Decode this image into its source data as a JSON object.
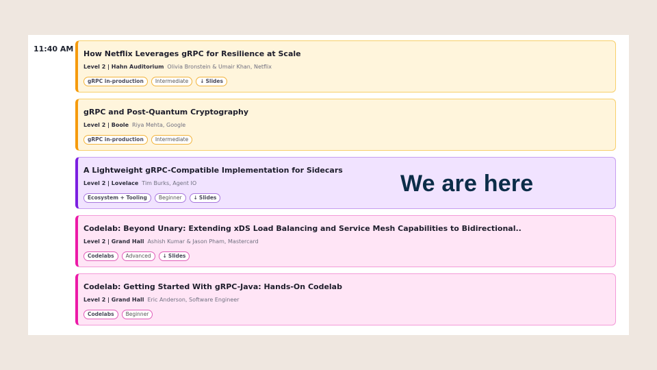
{
  "time": "11:40 AM",
  "overlay_text": "We are here",
  "colors": {
    "page_bg": "#efe7e0",
    "orange_accent": "#f59a0c",
    "purple_accent": "#7b1fe0",
    "pink_accent": "#ec1aa7",
    "overlay": "#0c2d48"
  },
  "sessions": [
    {
      "title": "How Netflix Leverages gRPC for Resilience at Scale",
      "location": "Level 2 | Hahn Auditorium",
      "speakers": "Olivia Bronstein & Umair Khan, Netflix",
      "track": "gRPC in-production",
      "level": "Intermediate",
      "slides": "Slides"
    },
    {
      "title": "gRPC and Post-Quantum Cryptography",
      "location": "Level 2 | Boole",
      "speakers": "Riya Mehta, Google",
      "track": "gRPC in-production",
      "level": "Intermediate"
    },
    {
      "title": "A Lightweight gRPC-Compatible Implementation for Sidecars",
      "location": "Level 2 | Lovelace",
      "speakers": "Tim Burks, Agent IO",
      "track": "Ecosystem + Tooling",
      "level": "Beginner",
      "slides": "Slides"
    },
    {
      "title": "Codelab: Beyond Unary: Extending xDS Load Balancing and Service Mesh Capabilities to Bidirectional..",
      "location": "Level 2 | Grand Hall",
      "speakers": "Ashish Kumar & Jason Pham, Mastercard",
      "track": "Codelabs",
      "level": "Advanced",
      "slides": "Slides"
    },
    {
      "title": "Codelab: Getting Started With gRPC-Java: Hands-On Codelab",
      "location": "Level 2 | Grand Hall",
      "speakers": "Eric Anderson, Software Engineer",
      "track": "Codelabs",
      "level": "Beginner"
    }
  ]
}
